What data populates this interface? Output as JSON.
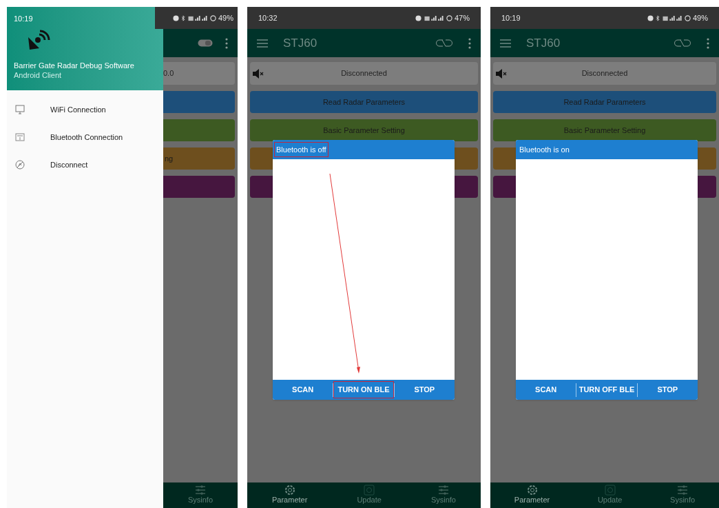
{
  "screens": [
    {
      "kind": "drawer",
      "status_bar": {
        "time": "10:19",
        "battery": "49%",
        "bluetooth": true
      },
      "drawer": {
        "title": "Barrier Gate Radar Debug Software",
        "subtitle": "Android Client",
        "items": [
          {
            "label": "WiFi Connection"
          },
          {
            "label": "Bluetooth Connection"
          },
          {
            "label": "Disconnect"
          }
        ]
      },
      "status_panel": {
        "text": "0.0"
      },
      "buttons": [
        {
          "color": "#1d4f7a"
        },
        {
          "color": "#3d5a22"
        },
        {
          "label": "ng",
          "color": "#6e4f1e"
        },
        {
          "color": "#46163f"
        }
      ],
      "nav": [
        {
          "label": "Sysinfo",
          "selected": false
        }
      ]
    },
    {
      "kind": "dialog",
      "status_bar": {
        "time": "10:32",
        "battery": "47%",
        "bluetooth": false
      },
      "app_bar": {
        "title": "STJ60"
      },
      "status_panel": {
        "text": "Disconnected"
      },
      "buttons": [
        {
          "label": "Read Radar Parameters",
          "color": "#1d4f7a"
        },
        {
          "label": "Basic Parameter Setting",
          "color": "#3d5a22"
        },
        {
          "color": "#6e4f1e"
        },
        {
          "color": "#46163f"
        }
      ],
      "dialog": {
        "title": "Bluetooth is off",
        "title_highlighted": true,
        "arrow_annotation": true,
        "actions": [
          {
            "label": "SCAN",
            "highlighted": false
          },
          {
            "label": "TURN ON BLE",
            "highlighted": true
          },
          {
            "label": "STOP",
            "highlighted": false
          }
        ]
      },
      "nav": [
        {
          "label": "Parameter",
          "selected": true
        },
        {
          "label": "Update",
          "selected": false
        },
        {
          "label": "Sysinfo",
          "selected": false
        }
      ]
    },
    {
      "kind": "dialog",
      "status_bar": {
        "time": "10:19",
        "battery": "49%",
        "bluetooth": true
      },
      "app_bar": {
        "title": "STJ60"
      },
      "status_panel": {
        "text": "Disconnected"
      },
      "buttons": [
        {
          "label": "Read Radar Parameters",
          "color": "#1d4f7a"
        },
        {
          "label": "Basic Parameter Setting",
          "color": "#3d5a22"
        },
        {
          "color": "#6e4f1e"
        },
        {
          "color": "#46163f"
        }
      ],
      "dialog": {
        "title": "Bluetooth is on",
        "title_highlighted": false,
        "arrow_annotation": false,
        "actions": [
          {
            "label": "SCAN",
            "highlighted": false
          },
          {
            "label": "TURN OFF BLE",
            "highlighted": false
          },
          {
            "label": "STOP",
            "highlighted": false
          }
        ]
      },
      "nav": [
        {
          "label": "Parameter",
          "selected": true
        },
        {
          "label": "Update",
          "selected": false
        },
        {
          "label": "Sysinfo",
          "selected": false
        }
      ]
    }
  ]
}
